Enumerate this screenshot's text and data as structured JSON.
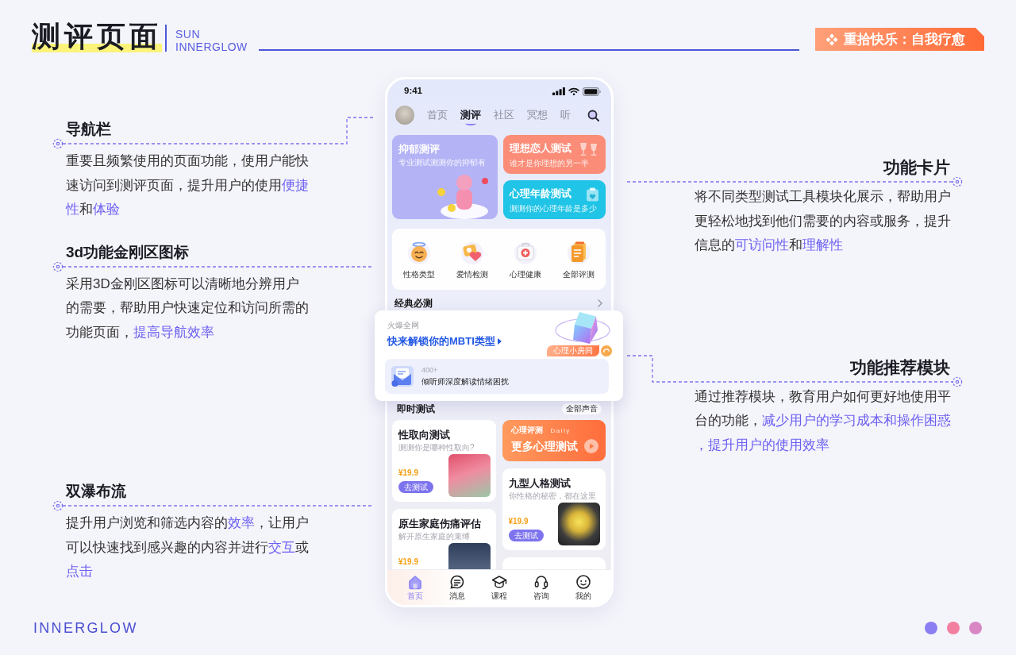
{
  "header": {
    "title": "测评页面",
    "subtitle_lines": [
      "SUN",
      "INNERGLOW"
    ],
    "badge": "重拾快乐：自我疗愈"
  },
  "left_annotations": [
    {
      "title": "导航栏",
      "text": "重要且频繁使用的页面功能，使用户能快速访问到测评页面，提升用户的使用**便捷性**和**体验**"
    },
    {
      "title": "3d功能金刚区图标",
      "text": "采用3D金刚区图标可以清晰地分辨用户的需要，帮助用户快速定位和访问所需的功能页面，**提高导航效率**"
    },
    {
      "title": "双瀑布流",
      "text": "提升用户浏览和筛选内容的**效率**，让用户可以快速找到感兴趣的内容并进行**交互**或**点击**"
    }
  ],
  "phone": {
    "status_bar": {
      "time": "9:41"
    },
    "nav_tabs": [
      {
        "label": "首页",
        "selected": false
      },
      {
        "label": "测评",
        "selected": true
      },
      {
        "label": "社区",
        "selected": false
      },
      {
        "label": "冥想",
        "selected": false
      },
      {
        "label": "听",
        "selected": false
      }
    ],
    "banners": [
      {
        "kind": "large",
        "title": "抑郁测评",
        "subtitle": "专业测试测测你的抑郁有",
        "color": "#b4b3f6"
      },
      {
        "kind": "small",
        "title": "理想恋人测试",
        "subtitle": "谁才是你理想的另一半",
        "color": "#fa8c78"
      },
      {
        "kind": "small",
        "title": "心理年龄测试",
        "subtitle": "测测你的心理年龄是多少",
        "color": "#1fc4e6"
      }
    ],
    "quick_entries": [
      {
        "label": "性格类型"
      },
      {
        "label": "爱情检测"
      },
      {
        "label": "心理健康"
      },
      {
        "label": "全部评测"
      }
    ],
    "classic_section": {
      "title": "经典必测"
    },
    "recommend_card": {
      "eyebrow": "火爆全网",
      "title": "快来解锁你的MBTI类型",
      "tag": "心理小房间",
      "count": "400+",
      "description": "倾听师深度解读情绪困扰"
    },
    "instant_section": {
      "title": "即时测试",
      "more": "全部声音",
      "columns": [
        [
          {
            "kind": "test",
            "title": "性取向测试",
            "subtitle": "测测你是哪种性取向?",
            "price": "¥19.9",
            "button": "去测试"
          },
          {
            "kind": "test",
            "title": "原生家庭伤痛评估",
            "subtitle": "解开原生家庭的束缚",
            "price": "¥19.9"
          }
        ],
        [
          {
            "kind": "promo",
            "eyebrow": "心理评测",
            "note": "Daily",
            "title": "更多心理测试"
          },
          {
            "kind": "test",
            "title": "九型人格测试",
            "subtitle": "你性格的秘密，都在这里",
            "price": "¥19.9",
            "button": "去测试"
          },
          {
            "kind": "stub"
          }
        ]
      ]
    },
    "tab_bar": [
      {
        "label": "首页",
        "selected": true
      },
      {
        "label": "消息",
        "selected": false
      },
      {
        "label": "课程",
        "selected": false
      },
      {
        "label": "咨询",
        "selected": false
      },
      {
        "label": "我的",
        "selected": false
      }
    ]
  },
  "right_annotations": [
    {
      "title": "功能卡片",
      "text": "将不同类型测试工具模块化展示，帮助用户更轻松地找到他们需要的内容或服务，提升信息的**可访问性**和**理解性**"
    },
    {
      "title": "功能推荐模块",
      "text": "通过推荐模块，教育用户如何更好地使用平台的功能，**减少用户的学习成本和操作困惑，提升用户的使用效率**"
    }
  ],
  "footer": {
    "brand": "INNERGLOW",
    "dots": [
      {
        "color": "#8b7ef2"
      },
      {
        "color": "#f27f9f"
      },
      {
        "color": "#d986c4"
      }
    ]
  }
}
